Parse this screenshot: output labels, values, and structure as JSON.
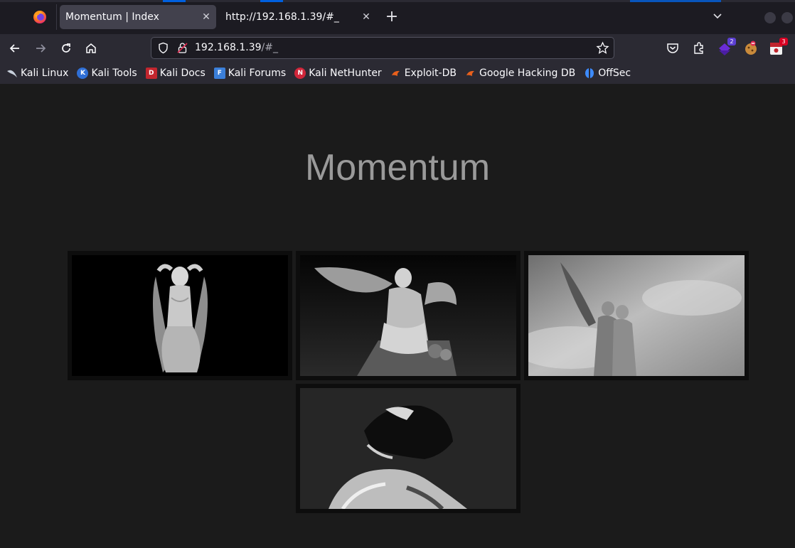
{
  "browser": {
    "tabs": [
      {
        "title": "Momentum | Index",
        "active": true
      },
      {
        "title": "http://192.168.1.39/#_",
        "active": false
      }
    ],
    "new_tab_symbol": "+",
    "close_symbol": "✕",
    "list_all_tabs_symbol": "⌄",
    "url": {
      "host": "192.168.1.39",
      "path": "/#_"
    },
    "nav_icons": [
      "back-icon",
      "forward-icon",
      "reload-icon",
      "home-icon"
    ],
    "extensions": [
      {
        "name": "pocket-icon"
      },
      {
        "name": "extensions-puzzle-icon"
      },
      {
        "name": "extension-purple-icon",
        "badge": "2"
      },
      {
        "name": "extension-cookie-icon"
      },
      {
        "name": "extension-red-icon",
        "badge": "3"
      }
    ],
    "bookmarks": [
      {
        "label": "Kali Linux",
        "icon": "kali-dragon-icon"
      },
      {
        "label": "Kali Tools",
        "icon": "kali-tools-icon"
      },
      {
        "label": "Kali Docs",
        "icon": "kali-docs-icon"
      },
      {
        "label": "Kali Forums",
        "icon": "kali-forums-icon"
      },
      {
        "label": "Kali NetHunter",
        "icon": "kali-nethunter-icon"
      },
      {
        "label": "Exploit-DB",
        "icon": "exploit-db-icon"
      },
      {
        "label": "Google Hacking DB",
        "icon": "ghdb-icon"
      },
      {
        "label": "OffSec",
        "icon": "offsec-icon"
      }
    ]
  },
  "page": {
    "title": "Momentum",
    "gallery": [
      {
        "name": "gallery-image-fallen-angel-statue"
      },
      {
        "name": "gallery-image-winged-angel-statue"
      },
      {
        "name": "gallery-image-angels-against-sky"
      },
      {
        "name": "gallery-image-statue-face-closeup"
      }
    ]
  },
  "colors": {
    "page_bg": "#1b1b1b",
    "title_color": "#9a9a9a",
    "accent_blue": "#0060df"
  }
}
